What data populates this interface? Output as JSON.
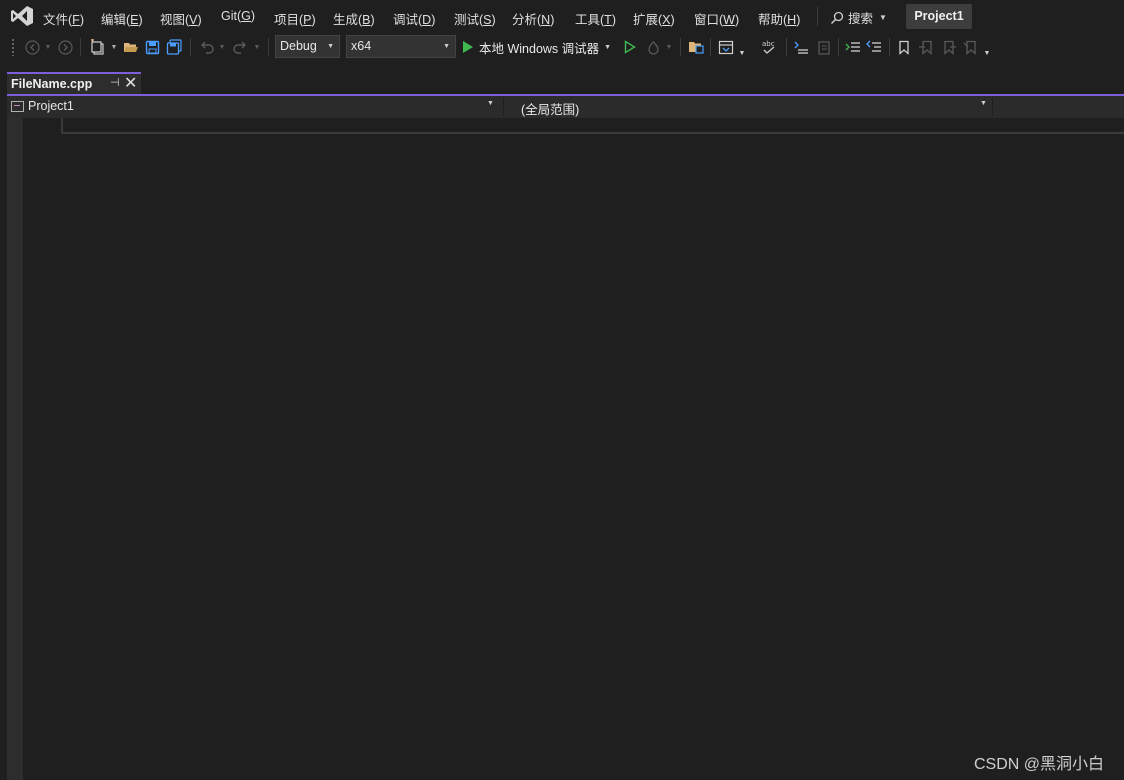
{
  "menubar": {
    "logo": "visual-studio-logo-icon",
    "items": [
      {
        "label": "文件(",
        "key": "F",
        "end": ")"
      },
      {
        "label": "编辑(",
        "key": "E",
        "end": ")"
      },
      {
        "label": "视图(",
        "key": "V",
        "end": ")"
      },
      {
        "label": "Git(",
        "key": "G",
        "end": ")"
      },
      {
        "label": "项目(",
        "key": "P",
        "end": ")"
      },
      {
        "label": "生成(",
        "key": "B",
        "end": ")"
      },
      {
        "label": "调试(",
        "key": "D",
        "end": ")"
      },
      {
        "label": "测试(",
        "key": "S",
        "end": ")"
      },
      {
        "label": "分析(",
        "key": "N",
        "end": ")"
      },
      {
        "label": "工具(",
        "key": "T",
        "end": ")"
      },
      {
        "label": "扩展(",
        "key": "X",
        "end": ")"
      },
      {
        "label": "窗口(",
        "key": "W",
        "end": ")"
      },
      {
        "label": "帮助(",
        "key": "H",
        "end": ")"
      }
    ],
    "search_label": "搜索",
    "project_name": "Project1"
  },
  "toolbar": {
    "configuration": "Debug",
    "platform": "x64",
    "run_label": "本地 Windows 调试器",
    "colors": {
      "run_green": "#3fb950",
      "folder_yellow": "#dcb67a",
      "save_blue": "#4a9eff"
    }
  },
  "tabs": [
    {
      "label": "FileName.cpp",
      "pinned_icon": "pin-icon",
      "close_icon": "close-icon"
    }
  ],
  "navbar": {
    "project": "Project1",
    "scope": "(全局范围)"
  },
  "theme": {
    "accent": "#7d5fdb",
    "background": "#1f1f1f"
  },
  "watermark": "CSDN @黑洞小白"
}
